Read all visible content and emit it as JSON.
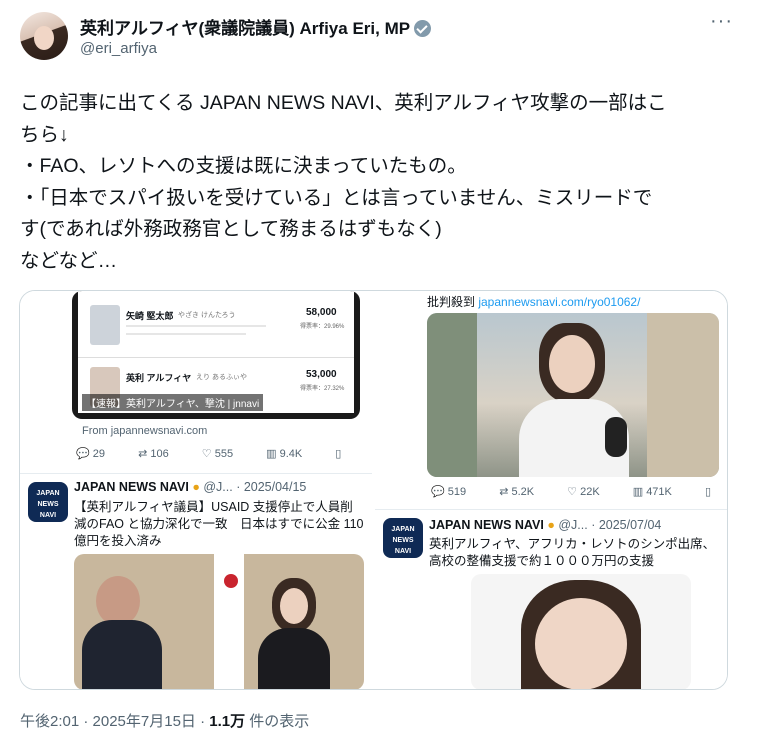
{
  "tweet": {
    "display_name": "英利アルフィヤ(衆議院議員) Arfiya Eri, MP",
    "handle": "@eri_arfiya",
    "more": "···",
    "text": "この記事に出てくる JAPAN NEWS NAVI、英利アルフィヤ攻撃の一部はこ\nちら↓\n・FAO、レソトへの支援は既に決まっていたもの。\n・「日本でスパイ扱いを受けている」とは言っていません、ミスリードで\nす(であれば外務政務官として務まるはずもなく)\nなどなど…",
    "time": "午後2:01 · 2025年7月15日 · ",
    "views_count": "1.1万",
    "views_label": " 件の表示"
  },
  "media": {
    "top_left": {
      "candidate1_name": "矢崎 堅太郎",
      "candidate1_kana": "やざき けんたろう",
      "candidate1_votes": "58,000",
      "candidate1_pct": "得票率：29.96%",
      "candidate2_name": "英利 アルフィヤ",
      "candidate2_kana": "えり あるふぃや",
      "candidate2_votes": "53,000",
      "candidate2_pct": "得票率：27.32%",
      "overlay": "【速報】英利アルフィヤ、撃沈 | jnnavi",
      "from": "From japannewsnavi.com",
      "stats": {
        "replies": "29",
        "retweets": "106",
        "likes": "555",
        "views": "9.4K"
      }
    },
    "top_right": {
      "caption_prefix": "批判殺到 ",
      "caption_link": "japannewsnavi.com/ryo01062/",
      "stats": {
        "replies": "519",
        "retweets": "5.2K",
        "likes": "22K",
        "views": "471K"
      }
    },
    "bottom_left": {
      "account": "JAPAN NEWS NAVI",
      "meta": "@J... · 2025/04/15",
      "text": "【英利アルフィヤ議員】USAID 支援停止で人員削減のFAO と協力深化で一致　日本はすでに公金 110 億円を投入済み",
      "logo": "JAPAN\nNEWS\nNAVI"
    },
    "bottom_right": {
      "account": "JAPAN NEWS NAVI",
      "meta": "@J... · 2025/07/04",
      "text": "英利アルフィヤ、アフリカ・レソトのシンポ出席、高校の整備支援で約１０００万円の支援",
      "logo": "JAPAN\nNEWS\nNAVI"
    }
  },
  "colors": {
    "accent": "#1d9bf0",
    "muted": "#536471",
    "text": "#0f1419",
    "verified": "#829aab",
    "border": "#cfd9de"
  }
}
